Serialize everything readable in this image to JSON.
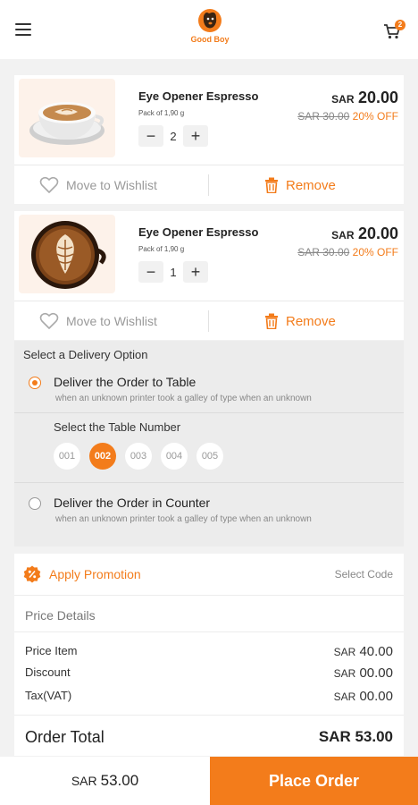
{
  "header": {
    "brand": "Good Boy",
    "cart_count": "2"
  },
  "cart_items": [
    {
      "name": "Eye Opener Espresso",
      "pack": "Pack of 1,90 g",
      "quantity": "2",
      "currency": "SAR",
      "price": "20.00",
      "old_price": "SAR 30.00",
      "discount": "20% OFF",
      "wishlist_label": "Move to Wishlist",
      "remove_label": "Remove"
    },
    {
      "name": "Eye Opener Espresso",
      "pack": "Pack of 1,90 g",
      "quantity": "1",
      "currency": "SAR",
      "price": "20.00",
      "old_price": "SAR 30.00",
      "discount": "20% OFF",
      "wishlist_label": "Move to Wishlist",
      "remove_label": "Remove"
    }
  ],
  "delivery": {
    "title": "Select a Delivery Option",
    "option_table": {
      "title": "Deliver the Order to Table",
      "desc": "when an unknown printer took a galley of type when an unknown",
      "selected": true
    },
    "table_label": "Select the Table Number",
    "tables": [
      "001",
      "002",
      "003",
      "004",
      "005"
    ],
    "selected_table": "002",
    "option_counter": {
      "title": "Deliver the Order in Counter",
      "desc": "when an unknown printer took a galley of type when an unknown",
      "selected": false
    }
  },
  "promotion": {
    "label": "Apply Promotion",
    "action": "Select Code"
  },
  "price_details": {
    "title": "Price Details",
    "rows": [
      {
        "label": "Price Item",
        "currency": "SAR",
        "value": "40.00"
      },
      {
        "label": "Discount",
        "currency": "SAR",
        "value": "00.00"
      },
      {
        "label": "Tax(VAT)",
        "currency": "SAR",
        "value": "00.00"
      }
    ],
    "total_label": "Order Total",
    "total_value": "SAR 53.00"
  },
  "footer": {
    "currency": "SAR",
    "total": "53.00",
    "place_order_label": "Place Order"
  },
  "colors": {
    "accent": "#f37c1b"
  }
}
